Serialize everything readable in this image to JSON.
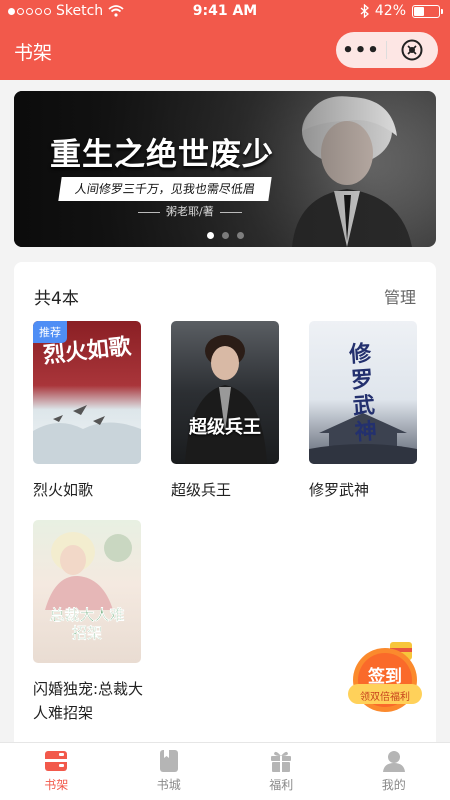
{
  "status": {
    "carrier": "Sketch",
    "time": "9:41 AM",
    "battery": "42%",
    "battery_level": 0.42
  },
  "nav": {
    "title": "书架",
    "more": "•••"
  },
  "banner": {
    "title": "重生之绝世废少",
    "subtitle": "人间修罗三千万，见我也需尽低眉",
    "author": "粥老耶/著",
    "pages": 3,
    "active_page": 1
  },
  "shelf": {
    "count": "共4本",
    "manage": "管理",
    "books": [
      {
        "name": "烈火如歌",
        "badge": "推荐",
        "cover_text": "烈火如歌"
      },
      {
        "name": "超级兵王",
        "badge": "",
        "cover_text": "超级兵王"
      },
      {
        "name": "修罗武神",
        "badge": "",
        "cover_text": "修罗武神"
      },
      {
        "name": "闪婚独宠:总裁大人难招架",
        "badge": "",
        "cover_text": "总裁大人难招架"
      }
    ]
  },
  "signin": {
    "title": "签到",
    "subtitle": "领双倍福利"
  },
  "tabs": [
    {
      "label": "书架",
      "icon": "bookshelf-icon",
      "active": true
    },
    {
      "label": "书城",
      "icon": "bookstore-icon",
      "active": false
    },
    {
      "label": "福利",
      "icon": "gift-icon",
      "active": false
    },
    {
      "label": "我的",
      "icon": "user-icon",
      "active": false
    }
  ],
  "colors": {
    "brand": "#f2594b",
    "badge": "#4f8ef5",
    "tab_inactive": "#888888"
  }
}
